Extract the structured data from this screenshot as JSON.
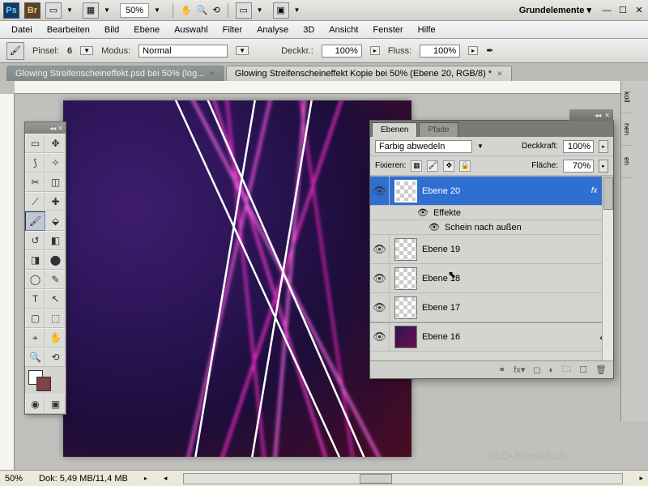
{
  "appbar": {
    "ps": "Ps",
    "br": "Br",
    "zoom": "50%",
    "workspace": "Grundelemente ▾"
  },
  "menu": [
    "Datei",
    "Bearbeiten",
    "Bild",
    "Ebene",
    "Auswahl",
    "Filter",
    "Analyse",
    "3D",
    "Ansicht",
    "Fenster",
    "Hilfe"
  ],
  "options": {
    "brush_label": "Pinsel:",
    "brush_size": "6",
    "mode_label": "Modus:",
    "mode_value": "Normal",
    "opacity_label": "Deckkr.:",
    "opacity_value": "100%",
    "flow_label": "Fluss:",
    "flow_value": "100%"
  },
  "tabs": [
    {
      "label": "Glowing Streifenscheineffekt.psd bei 50% (log...",
      "active": false
    },
    {
      "label": "Glowing Streifenscheineffekt Kopie bei 50% (Ebene 20, RGB/8) *",
      "active": true
    }
  ],
  "panel": {
    "tab1": "Ebenen",
    "tab2": "Pfade",
    "blend_value": "Farbig abwedeln",
    "opacity_label": "Deckkraft:",
    "opacity_value": "100%",
    "lock_label": "Fixieren:",
    "fill_label": "Fläche:",
    "fill_value": "70%",
    "fx_label": "fx",
    "effects_label": "Effekte",
    "outerglow_label": "Schein nach außen"
  },
  "layers": [
    {
      "name": "Ebene 20",
      "selected": true,
      "fx": true
    },
    {
      "name": "Ebene 19"
    },
    {
      "name": "Ebene 18"
    },
    {
      "name": "Ebene 17"
    },
    {
      "name": "Ebene 16",
      "special": true
    }
  ],
  "rightdock": [
    "koll",
    "nen",
    "en"
  ],
  "status": {
    "zoom": "50%",
    "docsize": "Dok: 5,49 MB/11,4 MB"
  },
  "watermark": "PSD-Tutorials.de",
  "icons": {
    "hand": "✋",
    "zoom": "🔍",
    "rotate": "⟲",
    "grid": "▦",
    "airbrush": "✒"
  }
}
